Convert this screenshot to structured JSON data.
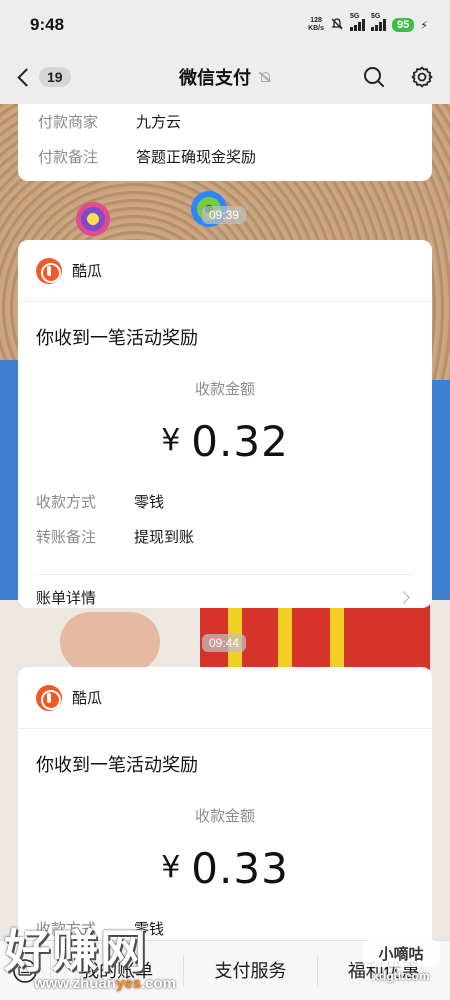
{
  "status_bar": {
    "time": "9:48",
    "net_speed_value": "128",
    "net_speed_unit": "KB/s",
    "signal1_tag": "5G",
    "signal2_tag": "5G",
    "battery": "95"
  },
  "nav": {
    "unread_count": "19",
    "title": "微信支付"
  },
  "top_card": {
    "rows": [
      {
        "label": "付款商家",
        "value": "九方云"
      },
      {
        "label": "付款备注",
        "value": "答题正确现金奖励"
      }
    ]
  },
  "messages": [
    {
      "time": "09:39",
      "merchant": "酷瓜",
      "title": "你收到一笔活动奖励",
      "amount_label": "收款金额",
      "currency": "¥",
      "amount": "0.32",
      "rows": [
        {
          "label": "收款方式",
          "value": "零钱"
        },
        {
          "label": "转账备注",
          "value": "提现到账"
        }
      ],
      "bill_link": "账单详情"
    },
    {
      "time": "09:44",
      "merchant": "酷瓜",
      "title": "你收到一笔活动奖励",
      "amount_label": "收款金额",
      "currency": "¥",
      "amount": "0.33",
      "rows": [
        {
          "label": "收款方式",
          "value": "零钱"
        }
      ]
    }
  ],
  "bottom_menu": {
    "items": [
      "我的账单",
      "支付服务",
      "福利优惠"
    ]
  },
  "watermark": {
    "big": "好赚网",
    "url_prefix": "www.zhuan",
    "url_highlight": "yes",
    "url_suffix": ".com",
    "right_top": "小嘀咕",
    "right_url": "xdgtt.com"
  },
  "colors": {
    "nav_bg": "#ededed",
    "card_bg": "#ffffff",
    "label_gray": "#8a8a8a",
    "battery_green": "#3fbd4a",
    "merchant_orange": "#f05a26"
  }
}
